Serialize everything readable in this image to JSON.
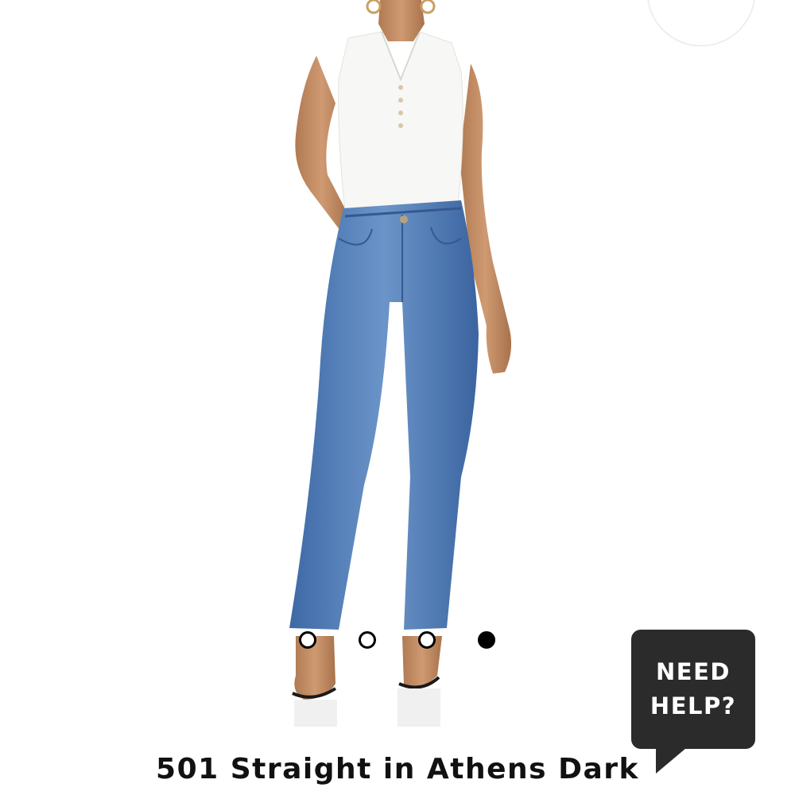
{
  "product": {
    "title": "501 Straight in Athens Dark"
  },
  "wishlist": {
    "icon": "heart-icon"
  },
  "carousel": {
    "image_count": 4,
    "active_index": 3
  },
  "help_widget": {
    "line1": "NEED",
    "line2": "HELP?"
  },
  "colors": {
    "accent": "#2b2b2b",
    "text": "#111111",
    "denim": "#4a78b4"
  }
}
